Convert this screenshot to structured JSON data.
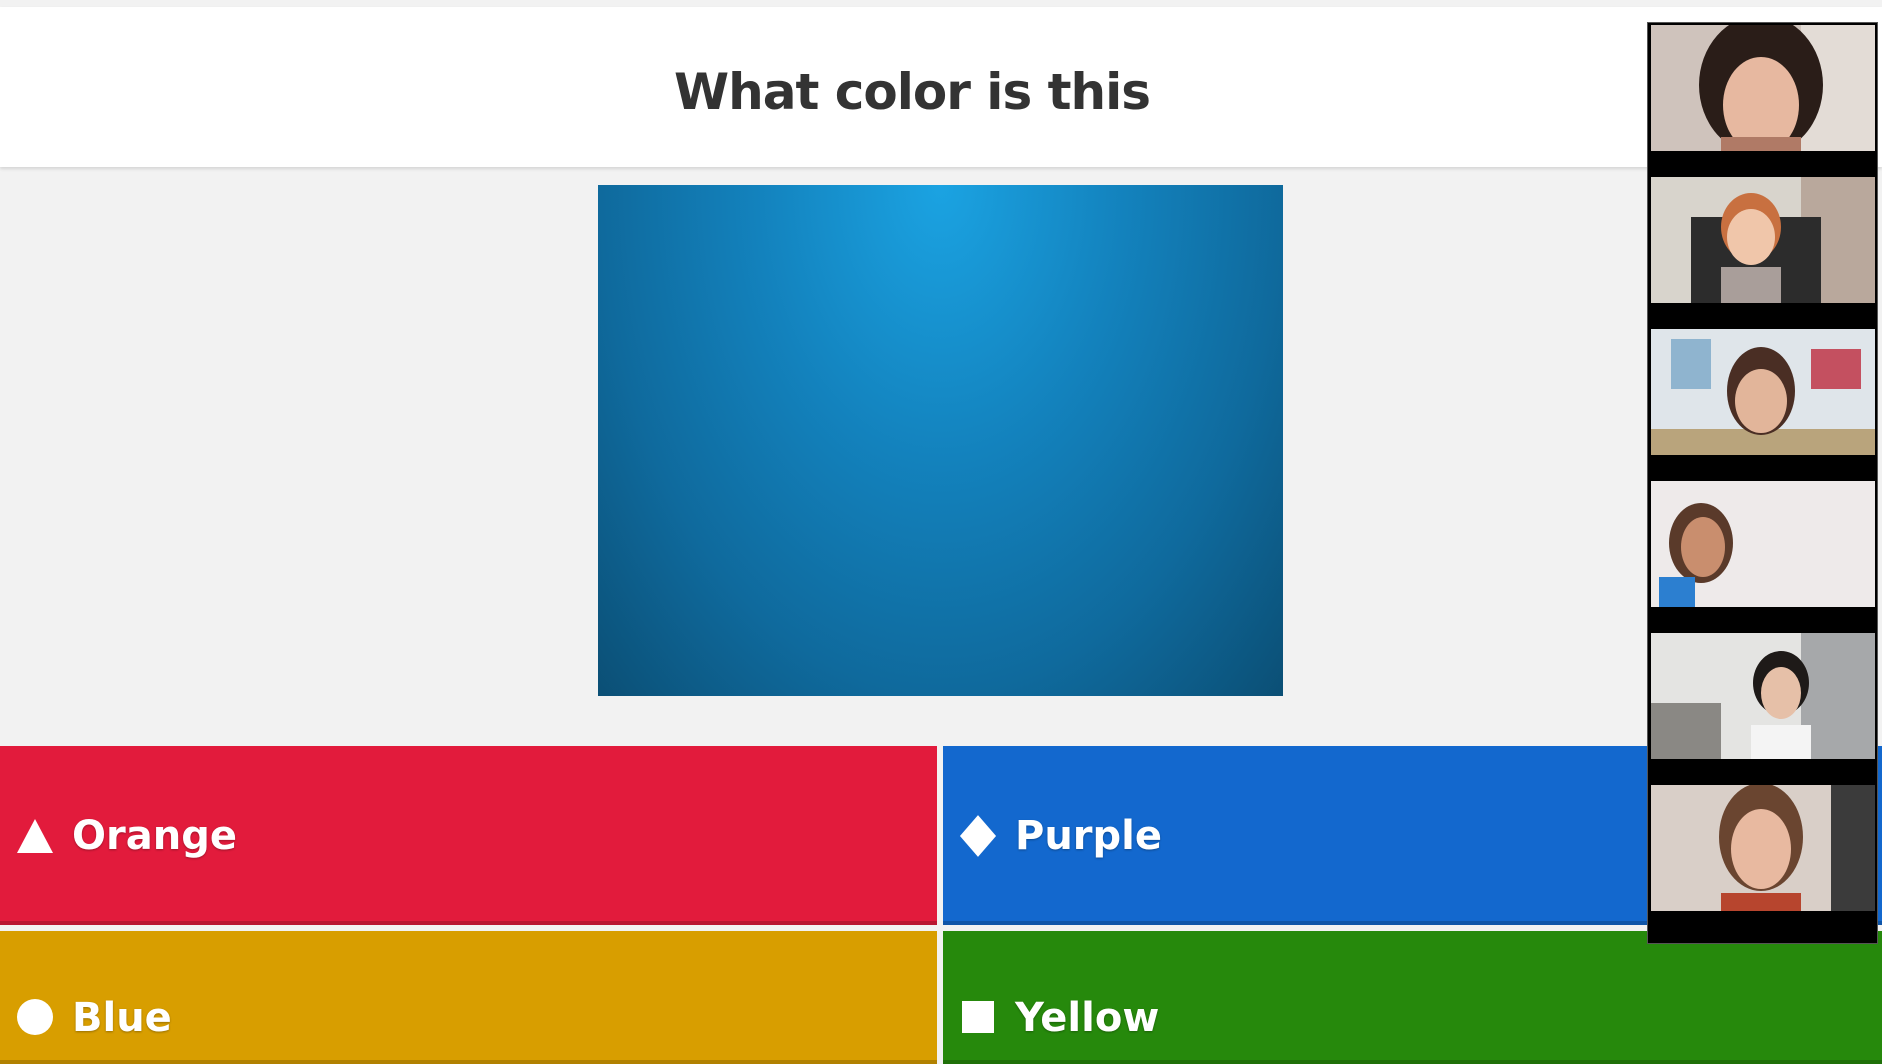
{
  "question": {
    "title": "What color is this"
  },
  "answers": [
    {
      "label": "Orange",
      "shape": "triangle-icon",
      "color": "#e21b3c"
    },
    {
      "label": "Purple",
      "shape": "diamond-icon",
      "color": "#1368ce"
    },
    {
      "label": "Blue",
      "shape": "circle-icon",
      "color": "#d89e00"
    },
    {
      "label": "Yellow",
      "shape": "square-icon",
      "color": "#26890c"
    }
  ],
  "image": {
    "color": "#1382bd"
  },
  "video_panel": {
    "participant_count": 6
  }
}
